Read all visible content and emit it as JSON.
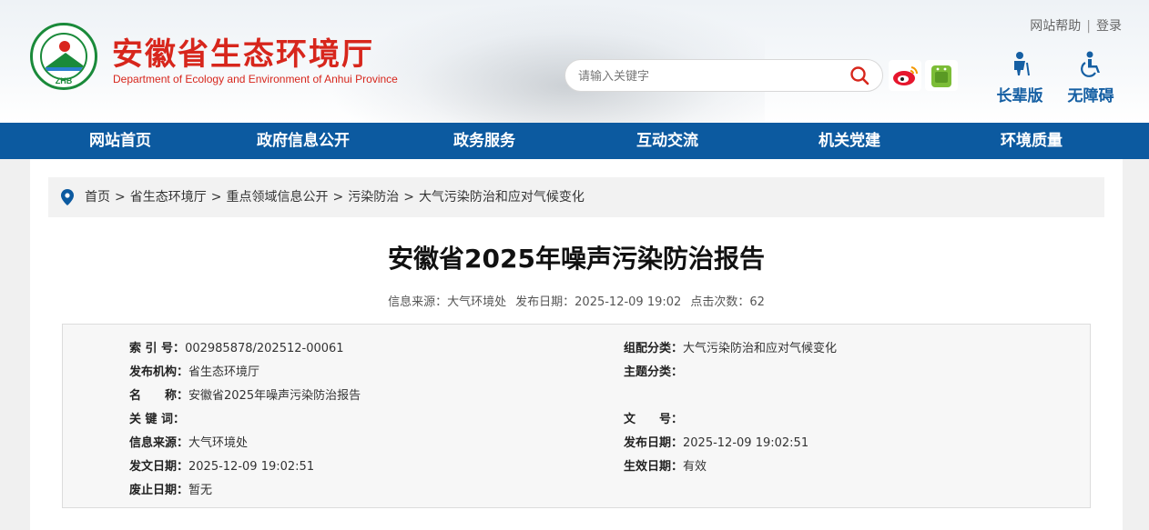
{
  "header": {
    "title": "安徽省生态环境厅",
    "subtitle": "Department of Ecology and Environment of Anhui Province",
    "logo_text": "ZHB",
    "top_links": [
      "网站帮助",
      "登录"
    ],
    "search_placeholder": "请输入关键字",
    "mode_buttons": [
      "长辈版",
      "无障碍"
    ]
  },
  "nav": {
    "items": [
      "网站首页",
      "政府信息公开",
      "政务服务",
      "互动交流",
      "机关党建",
      "环境质量"
    ]
  },
  "breadcrumb": {
    "items": [
      "首页",
      "省生态环境厅",
      "重点领域信息公开",
      "污染防治",
      "大气污染防治和应对气候变化"
    ],
    "separator": ">"
  },
  "article": {
    "title": "安徽省2025年噪声污染防治报告",
    "source_label": "信息来源：大气环境处",
    "date_label": "发布日期：2025-12-09 19:02",
    "clicks_label": "点击次数：62"
  },
  "info": {
    "left": [
      {
        "k": "索 引 号：",
        "v": "002985878/202512-00061"
      },
      {
        "k": "发布机构：",
        "v": "省生态环境厅"
      },
      {
        "k": "名　　称：",
        "v": "安徽省2025年噪声污染防治报告"
      },
      {
        "k": "关 键 词：",
        "v": ""
      },
      {
        "k": "信息来源：",
        "v": "大气环境处"
      },
      {
        "k": "发文日期：",
        "v": "2025-12-09 19:02:51"
      },
      {
        "k": "废止日期：",
        "v": "暂无"
      }
    ],
    "right": [
      {
        "k": "组配分类：",
        "v": "大气污染防治和应对气候变化"
      },
      {
        "k": "主题分类：",
        "v": ""
      },
      {
        "k": "文　　号：",
        "v": ""
      },
      {
        "k": "发布日期：",
        "v": "2025-12-09 19:02:51"
      },
      {
        "k": "生效日期：",
        "v": "有效"
      }
    ]
  },
  "colors": {
    "brand_red": "#d7261c",
    "nav_blue": "#0c5aa0",
    "accent_blue": "#155fa3"
  },
  "icons": [
    "search-icon",
    "weibo-icon",
    "android-icon",
    "elderly-icon",
    "accessibility-icon",
    "location-pin-icon"
  ]
}
